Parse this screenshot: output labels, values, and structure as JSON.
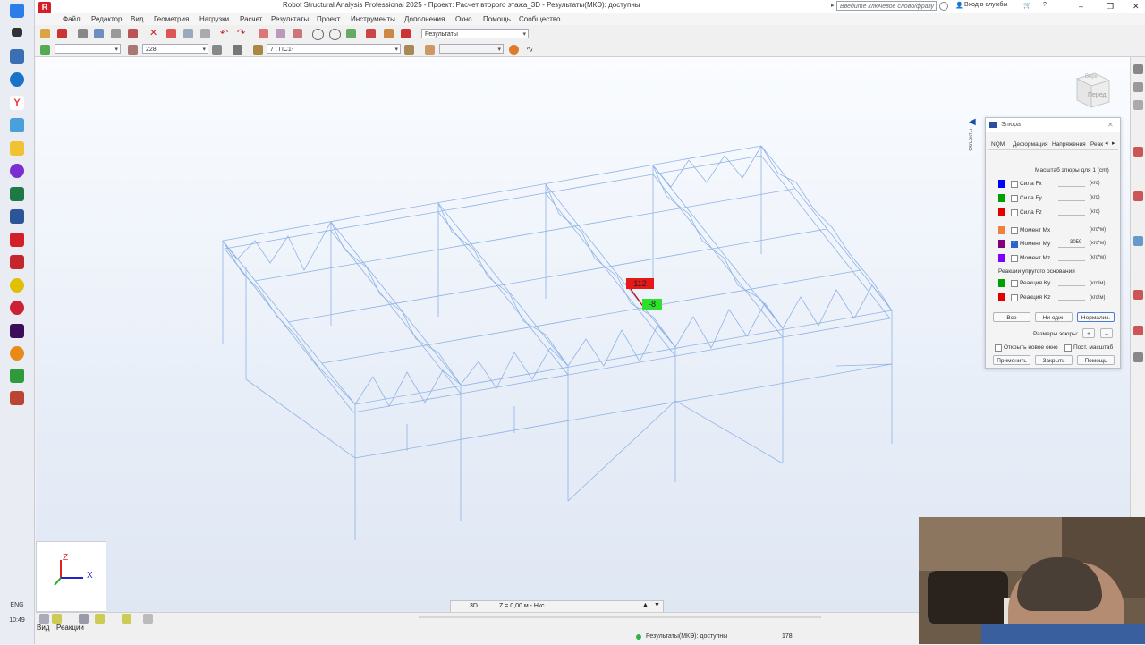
{
  "app": {
    "logo_letter": "R",
    "title": "Robot Structural Analysis Professional 2025 - Проект: Расчет второго этажа_3D - Результаты(МКЭ): доступны",
    "search_placeholder": "Введите ключевое слово/фразу",
    "signin": "Вход в службы",
    "help": "?",
    "min": "–",
    "max": "❐",
    "close": "✕"
  },
  "menu": [
    "Файл",
    "Редактор",
    "Вид",
    "Геометрия",
    "Нагрузки",
    "Расчет",
    "Результаты",
    "Проект",
    "Инструменты",
    "Дополнения",
    "Окно",
    "Помощь",
    "Сообщество"
  ],
  "toolbar": {
    "results_dropdown": "Результаты",
    "number_field": "228",
    "case_dropdown": "7 : ПС1-"
  },
  "viewport": {
    "view_cube_label": "Перед",
    "view_cube_top": "Верх",
    "diagram_labels": {
      "red": "112",
      "green": "-8"
    },
    "axis": {
      "z": "Z",
      "x": "X"
    }
  },
  "side_tab": {
    "label": "Объекты"
  },
  "diagram_panel": {
    "title": "Эпюра",
    "tabs": [
      "NQM",
      "Деформация",
      "Напряжения",
      "Реак"
    ],
    "scale_label": "Масштаб эпюры для 1  (cm)",
    "rows": [
      {
        "label": "Сила Fx",
        "unit": "(кгс)",
        "color": "#0000ff",
        "checked": false,
        "value": ""
      },
      {
        "label": "Сила Fy",
        "unit": "(кгс)",
        "color": "#00a000",
        "checked": false,
        "value": ""
      },
      {
        "label": "Сила Fz",
        "unit": "(кгс)",
        "color": "#e00000",
        "checked": false,
        "value": ""
      },
      {
        "label": "Момент Mx",
        "unit": "(кгс*м)",
        "color": "#f08040",
        "checked": false,
        "value": ""
      },
      {
        "label": "Момент My",
        "unit": "(кгс*м)",
        "color": "#800080",
        "checked": true,
        "value": "3059"
      },
      {
        "label": "Момент Mz",
        "unit": "(кгс*м)",
        "color": "#8000ff",
        "checked": false,
        "value": ""
      }
    ],
    "elastic_title": "Реакции упругого основания",
    "elastic_rows": [
      {
        "label": "Реакция Ky",
        "unit": "(кгс/м)",
        "color": "#00a000",
        "checked": false
      },
      {
        "label": "Реакция Kz",
        "unit": "(кгс/м)",
        "color": "#e00000",
        "checked": false
      }
    ],
    "btn_all": "Все",
    "btn_none": "Ни один",
    "btn_normalize": "Нормализ.",
    "sizes_label": "Размеры эпюры:",
    "plus": "+",
    "minus": "–",
    "open_new_window": "Открыть новое окно",
    "const_scale": "Пост. масштаб",
    "btn_apply": "Применить",
    "btn_close": "Закрыть",
    "btn_help": "Помощь"
  },
  "view_info": {
    "mode": "3D",
    "level": "Z = 0,00 м - Нкс"
  },
  "bottom_tabs": [
    "Вид",
    "Реакции"
  ],
  "status": {
    "text": "Результаты(МКЭ): доступны",
    "value": "178"
  },
  "taskbar": {
    "lang": "ENG",
    "time": "10:49"
  },
  "colors": {
    "wire": "#8fb3e6",
    "label_red": "#e61919",
    "label_green": "#2ee02e",
    "brand": "#d21f2a"
  }
}
